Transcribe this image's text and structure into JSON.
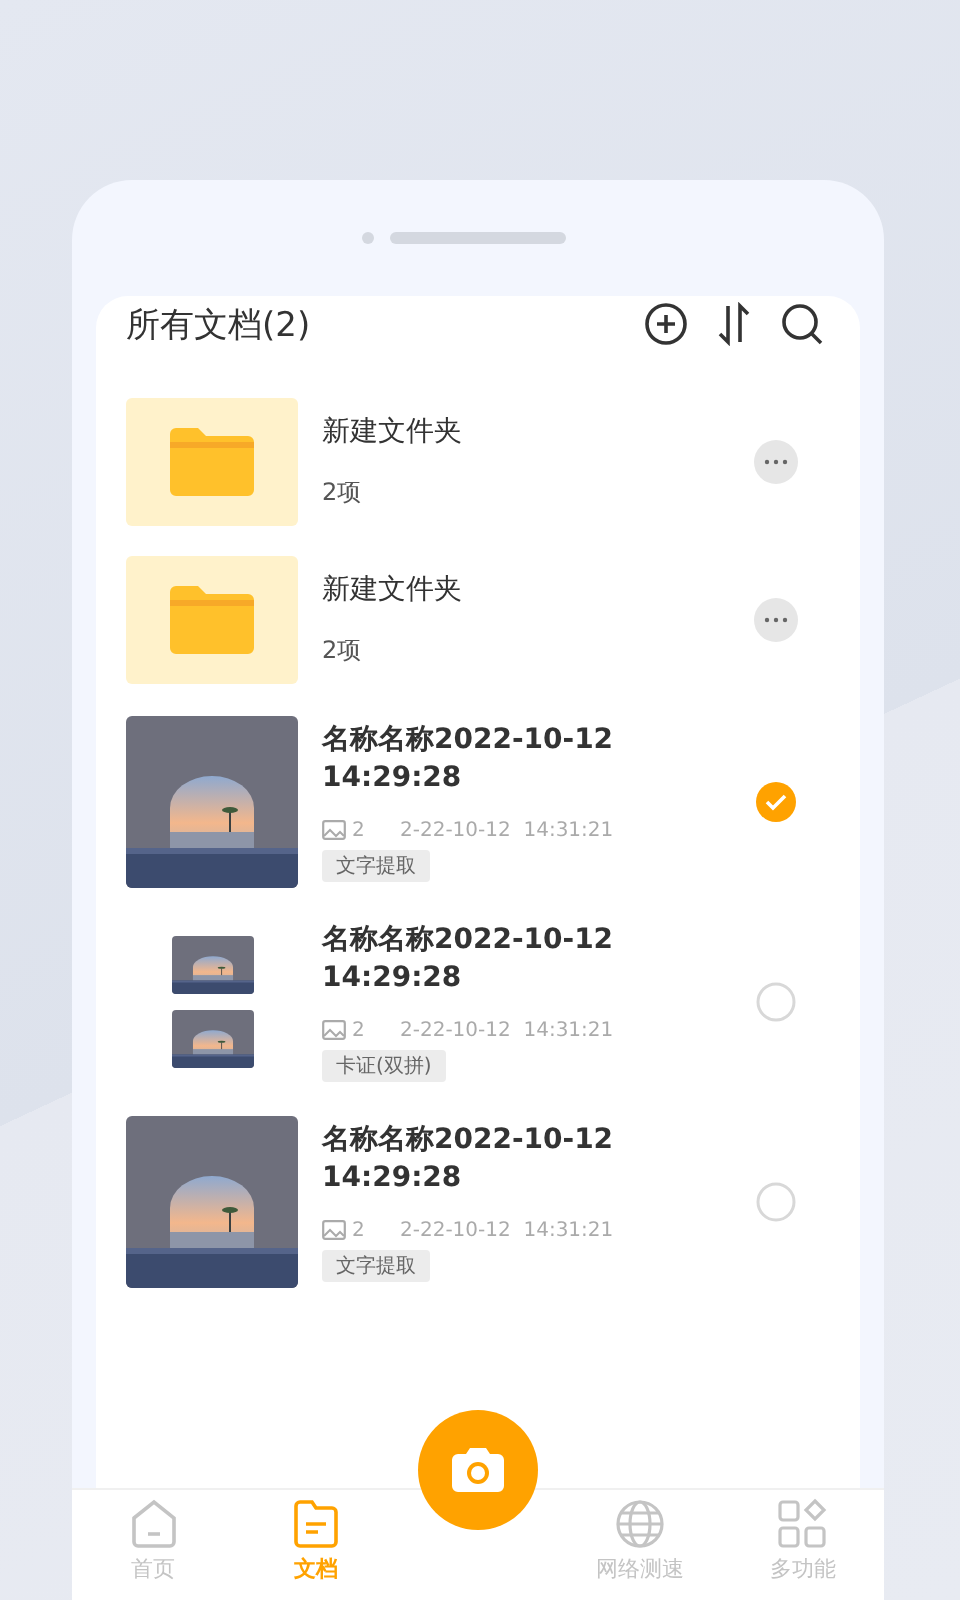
{
  "header": {
    "title": "所有文档(2)"
  },
  "items": [
    {
      "kind": "folder",
      "name": "新建文件夹",
      "count": "2项"
    },
    {
      "kind": "folder",
      "name": "新建文件夹",
      "count": "2项"
    },
    {
      "name": "名称名称2022-10-12 14:29:28",
      "pages": "2",
      "time": "2-22-10-12  14:31:21",
      "tag": "文字提取",
      "selected": true
    },
    {
      "kind": "pair",
      "name": "名称名称2022-10-12 14:29:28",
      "pages": "2",
      "time": "2-22-10-12  14:31:21",
      "tag": "卡证(双拼)",
      "selected": false
    },
    {
      "name": "名称名称2022-10-12 14:29:28",
      "pages": "2",
      "time": "2-22-10-12  14:31:21",
      "tag": "文字提取",
      "selected": false
    }
  ],
  "nav": [
    {
      "kind": "home",
      "label": "首页",
      "selected": false
    },
    {
      "kind": "docs",
      "label": "文档",
      "selected": true
    },
    {
      "kind": "camera",
      "selected": false
    },
    {
      "kind": "globe",
      "label": "网络测速",
      "selected": false
    },
    {
      "kind": "apps",
      "label": "多功能",
      "selected": false
    }
  ]
}
